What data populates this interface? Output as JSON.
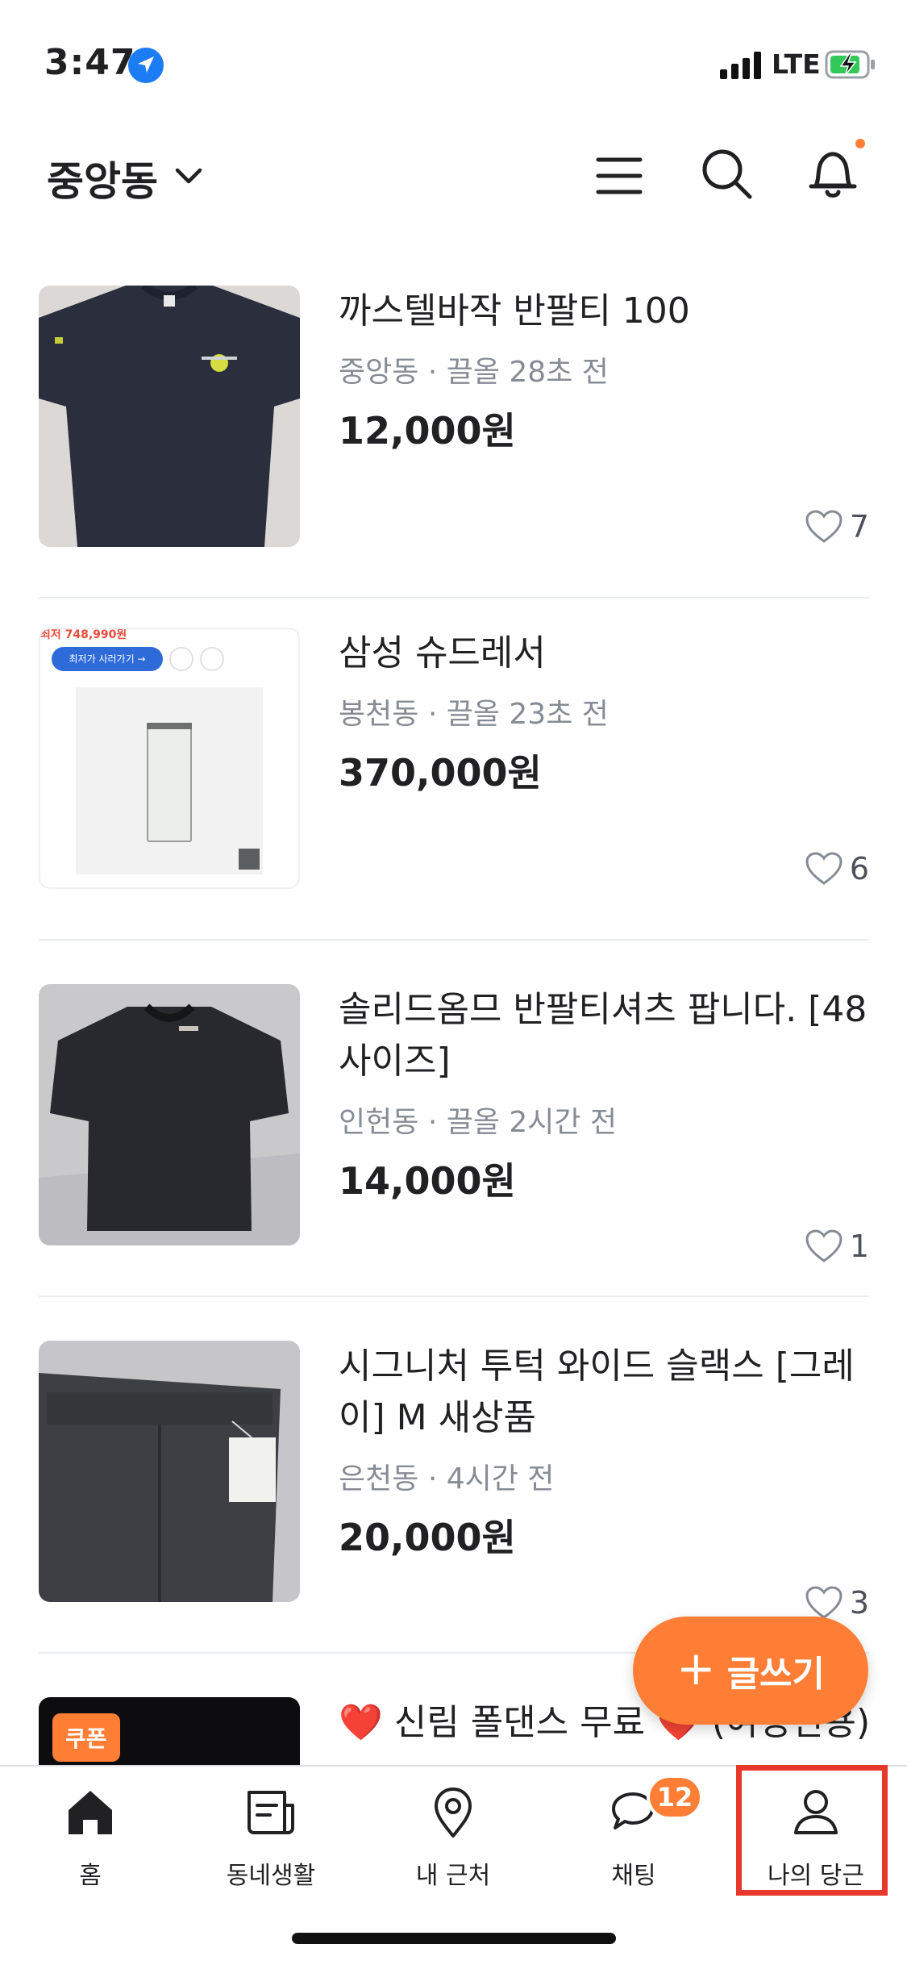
{
  "status_bar": {
    "time": "3:47",
    "network": "LTE"
  },
  "header": {
    "location": "중앙동"
  },
  "items": [
    {
      "title": "까스텔바작 반팔티 100",
      "location": "중앙동",
      "time": "끌올 28초 전",
      "price": "12,000원",
      "likes": "7"
    },
    {
      "title": "삼성 슈드레서",
      "location": "봉천동",
      "time": "끌올 23초 전",
      "price": "370,000원",
      "likes": "6",
      "thumb_price": "최저 748,990원",
      "thumb_button": "최저가 사러가기 →"
    },
    {
      "title": "솔리드옴므 반팔티셔츠 팝니다. [48사이즈]",
      "location": "인헌동",
      "time": "끌올 2시간 전",
      "price": "14,000원",
      "likes": "1"
    },
    {
      "title": "시그니처 투턱 와이드 슬랙스 [그레이] M 새상품",
      "location": "은천동",
      "time": "4시간 전",
      "price": "20,000원",
      "likes": "3"
    },
    {
      "title": "❤️ 신림 폴댄스 무료 ❤️ (여성전용)",
      "coupon": "쿠폰"
    }
  ],
  "meta_separator": " · ",
  "fab": {
    "label": "글쓰기"
  },
  "tabs": [
    {
      "label": "홈",
      "icon": "home-icon"
    },
    {
      "label": "동네생활",
      "icon": "newspaper-icon"
    },
    {
      "label": "내 근처",
      "icon": "location-pin-icon"
    },
    {
      "label": "채팅",
      "icon": "chat-icon",
      "badge": "12"
    },
    {
      "label": "나의 당근",
      "icon": "person-icon"
    }
  ],
  "colors": {
    "accent": "#ff7e36",
    "highlight": "#e8372b",
    "meta": "#868b94",
    "divider": "#e9ecef"
  }
}
